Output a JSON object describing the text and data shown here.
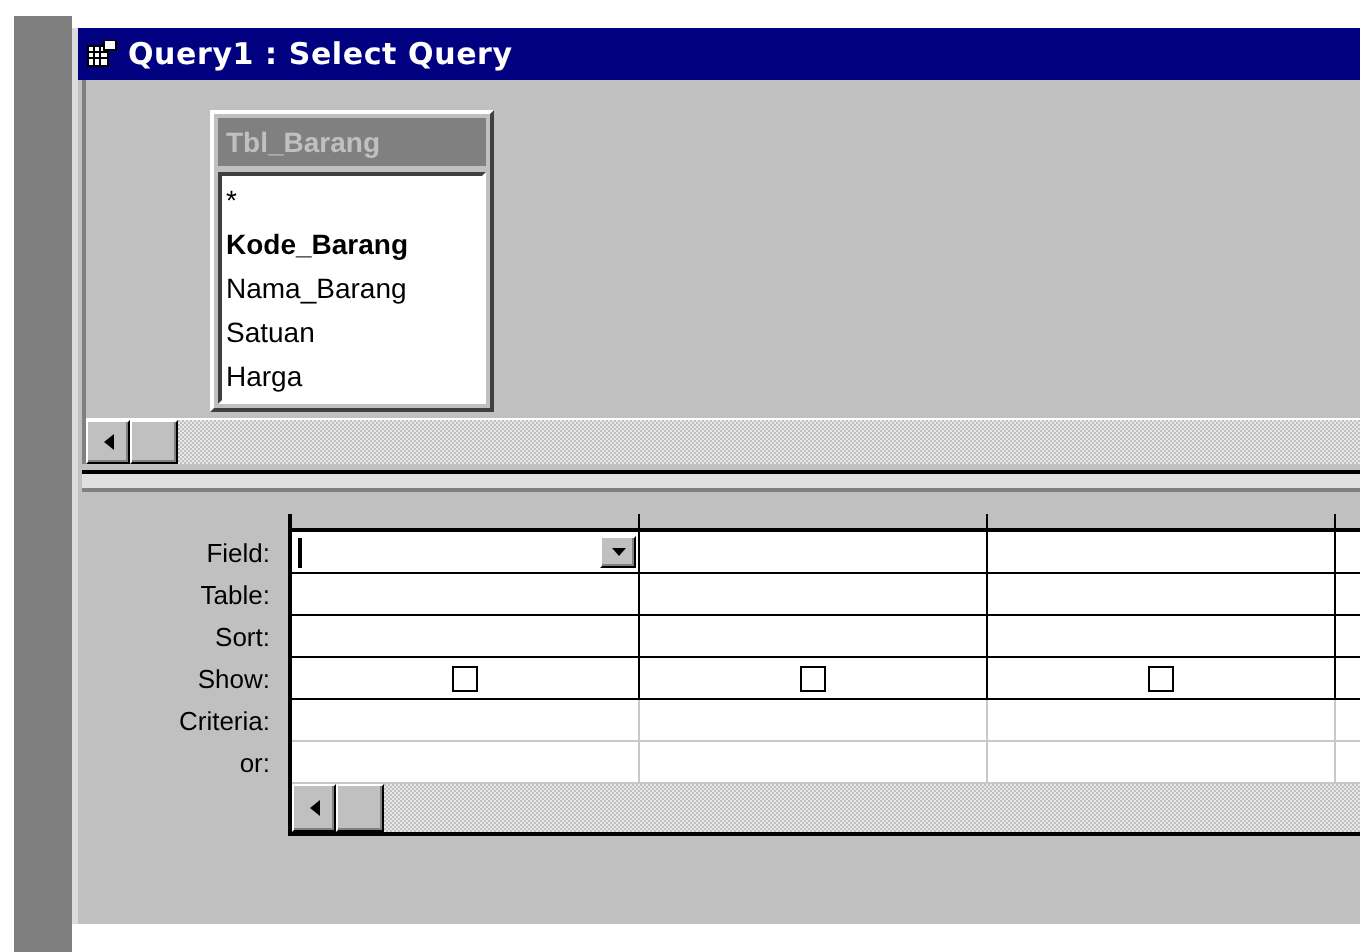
{
  "window": {
    "title": "Query1 : Select Query"
  },
  "field_list": {
    "title": "Tbl_Barang",
    "fields": [
      {
        "name": "*",
        "key": false
      },
      {
        "name": "Kode_Barang",
        "key": true
      },
      {
        "name": "Nama_Barang",
        "key": false
      },
      {
        "name": "Satuan",
        "key": false
      },
      {
        "name": "Harga",
        "key": false
      }
    ]
  },
  "grid": {
    "row_labels": [
      "Field:",
      "Table:",
      "Sort:",
      "Show:",
      "Criteria:",
      "or:"
    ],
    "columns": [
      {
        "focused": true,
        "show": false
      },
      {
        "focused": false,
        "show": false
      },
      {
        "focused": false,
        "show": false
      }
    ]
  }
}
